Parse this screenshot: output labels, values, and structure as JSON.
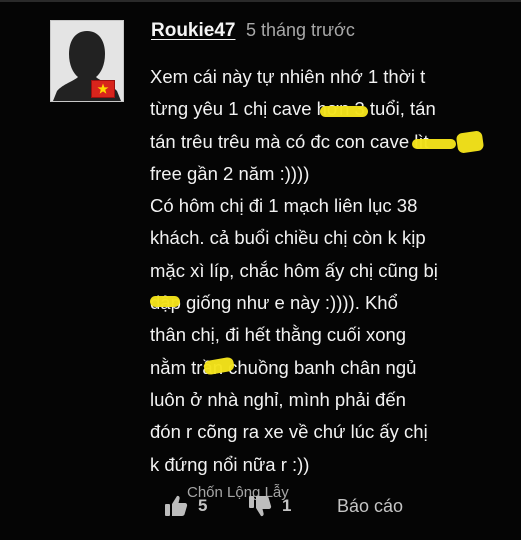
{
  "comment": {
    "username": "Roukie47",
    "timestamp": "5 tháng trước",
    "text_lines": [
      "Xem cái này tự nhiên nhớ 1 thời t",
      "từng yêu 1 chị cave hơn 3 tuổi, tán",
      "tán trêu trêu mà có đc con cave lìt",
      "free gần 2 năm :))))",
      "Có hôm chị đi 1 mạch liên lục 38",
      "khách. cả buổi chiều chị còn k kịp",
      "mặc xì líp, chắc hôm ấy chị cũng bị",
      "dập giống như e này :)))). Khổ",
      "thân chị, đi hết thằng cuối xong",
      "nằm trần chuồng banh chân ngủ",
      "luôn ở nhà nghỉ, mình phải đến",
      "đón r cõng ra xe về chứ lúc ấy chị",
      "k đứng nổi nữa r :))"
    ],
    "likes": "5",
    "dislikes": "1",
    "report_label": "Báo cáo"
  },
  "watermark": "Chốn Lộng Lẫy",
  "colors": {
    "background": "#050505",
    "text": "#f2f2f2",
    "muted": "#a8a8a8",
    "highlight": "#f4e31b",
    "flag_red": "#d8241c",
    "flag_star": "#ffd900"
  },
  "icons": {
    "avatar": "default-user-silhouette",
    "flag": "vietnam-flag-icon",
    "like": "thumbs-up-icon",
    "dislike": "thumbs-down-icon"
  }
}
